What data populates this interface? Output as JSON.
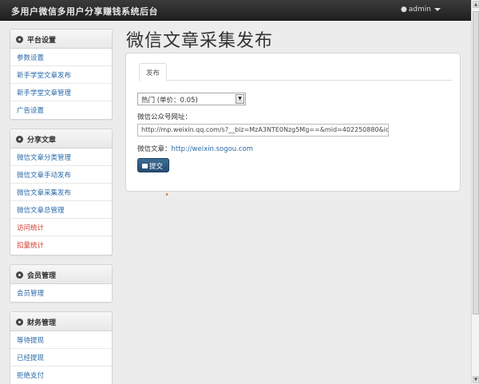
{
  "header": {
    "brand": "多用户微信多用户分享赚钱系统后台",
    "user_label": "admin"
  },
  "sidebar": {
    "panels": [
      {
        "title": "平台设置",
        "items": [
          "参数设置",
          "新手学堂文章发布",
          "新手学堂文章管理",
          "广告设置"
        ]
      },
      {
        "title": "分享文章",
        "items": [
          "微信文章分类管理",
          "微信文章手动发布",
          "微信文章采集发布",
          "微信文章总管理",
          "访问统计",
          "扣量统计"
        ]
      },
      {
        "title": "会员管理",
        "items": [
          "会员管理"
        ]
      },
      {
        "title": "财务管理",
        "items": [
          "等待提现",
          "已经提现",
          "拒绝支付"
        ]
      }
    ]
  },
  "main": {
    "title": "微信文章采集发布",
    "tab": "发布",
    "select_value": "热门 (单价：0.05)",
    "url_label": "微信公众号网址：",
    "url_value": "http://mp.weixin.qq.com/s?__biz=MzA3NTE0Nzg5Mg==&mid=402250880&idx=1&",
    "article_label": "微信文章：",
    "article_link": "http://weixin.sogou.com",
    "submit_label": "提交"
  },
  "colors": {
    "link": "#2a6aa8",
    "alert_link": "#d23a2a",
    "button": "#2c5679",
    "navbar": "#2a2a2a"
  }
}
